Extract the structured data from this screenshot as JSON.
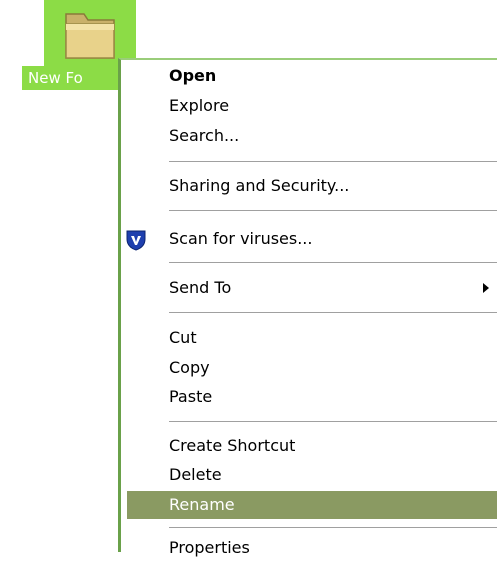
{
  "desktop": {
    "folder_label": "New Fo",
    "folder_icon": "folder-icon"
  },
  "context_menu": {
    "open": "Open",
    "explore": "Explore",
    "search": "Search...",
    "sharing": "Sharing and Security...",
    "scan": "Scan for viruses...",
    "scan_icon": "antivirus-shield-icon",
    "send_to": "Send To",
    "cut": "Cut",
    "copy": "Copy",
    "paste": "Paste",
    "create_shortcut": "Create Shortcut",
    "delete": "Delete",
    "rename": "Rename",
    "properties": "Properties"
  },
  "colors": {
    "selection_green": "#8cdc46",
    "menu_highlight": "#8a9a62",
    "menu_border": "#6aa14a"
  }
}
